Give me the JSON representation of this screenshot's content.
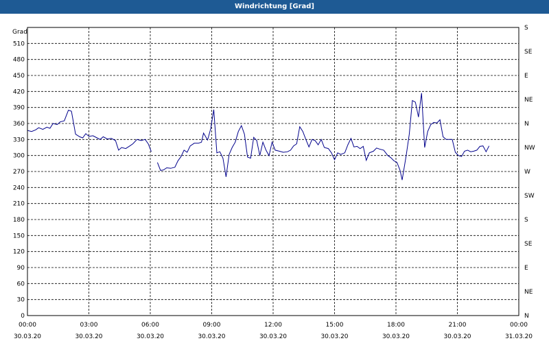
{
  "chart_data": {
    "type": "line",
    "title": "Windrichtung [Grad]",
    "ylabel": "Grad",
    "ylim": [
      0,
      540
    ],
    "yticks": [
      0,
      30,
      60,
      90,
      120,
      150,
      180,
      210,
      240,
      270,
      300,
      330,
      360,
      390,
      420,
      450,
      480,
      510
    ],
    "y2ticks": [
      {
        "value": 0,
        "label": "N"
      },
      {
        "value": 45,
        "label": "NE"
      },
      {
        "value": 90,
        "label": "E"
      },
      {
        "value": 135,
        "label": "SE"
      },
      {
        "value": 180,
        "label": "S"
      },
      {
        "value": 225,
        "label": "SW"
      },
      {
        "value": 270,
        "label": "W"
      },
      {
        "value": 315,
        "label": "NW"
      },
      {
        "value": 360,
        "label": "N"
      },
      {
        "value": 405,
        "label": "NE"
      },
      {
        "value": 450,
        "label": "E"
      },
      {
        "value": 495,
        "label": "SE"
      },
      {
        "value": 540,
        "label": "S"
      }
    ],
    "xlim": [
      0,
      24
    ],
    "xticks": [
      {
        "hour": 0,
        "time": "00:00",
        "date": "30.03.20"
      },
      {
        "hour": 3,
        "time": "03:00",
        "date": "30.03.20"
      },
      {
        "hour": 6,
        "time": "06:00",
        "date": "30.03.20"
      },
      {
        "hour": 9,
        "time": "09:00",
        "date": "30.03.20"
      },
      {
        "hour": 12,
        "time": "12:00",
        "date": "30.03.20"
      },
      {
        "hour": 15,
        "time": "15:00",
        "date": "30.03.20"
      },
      {
        "hour": 18,
        "time": "18:00",
        "date": "30.03.20"
      },
      {
        "hour": 21,
        "time": "21:00",
        "date": "30.03.20"
      },
      {
        "hour": 24,
        "time": "00:00",
        "date": "31.03.20"
      }
    ],
    "grid": true,
    "colors": {
      "line": "#00008b",
      "titlebar": "#1e5a94"
    },
    "series": [
      {
        "segments": [
          [
            [
              0.0,
              347
            ],
            [
              0.2,
              345
            ],
            [
              0.4,
              348
            ],
            [
              0.55,
              352
            ],
            [
              0.75,
              349
            ],
            [
              0.95,
              353
            ],
            [
              1.1,
              351
            ],
            [
              1.25,
              360
            ],
            [
              1.45,
              358
            ],
            [
              1.6,
              363
            ],
            [
              1.8,
              365
            ],
            [
              1.9,
              375
            ],
            [
              2.0,
              385
            ],
            [
              2.15,
              383
            ],
            [
              2.35,
              340
            ],
            [
              2.55,
              335
            ],
            [
              2.7,
              333
            ],
            [
              2.85,
              341
            ],
            [
              3.0,
              336
            ],
            [
              3.2,
              337
            ],
            [
              3.4,
              333
            ],
            [
              3.55,
              330
            ],
            [
              3.7,
              335
            ],
            [
              3.9,
              331
            ],
            [
              4.1,
              332
            ],
            [
              4.3,
              328
            ],
            [
              4.45,
              310
            ],
            [
              4.6,
              315
            ],
            [
              4.8,
              313
            ],
            [
              5.0,
              318
            ],
            [
              5.15,
              322
            ],
            [
              5.35,
              330
            ],
            [
              5.55,
              328
            ],
            [
              5.75,
              330
            ],
            [
              5.9,
              322
            ],
            [
              6.05,
              307
            ]
          ],
          [
            [
              6.35,
              287
            ],
            [
              6.5,
              272
            ],
            [
              6.65,
              273
            ],
            [
              6.8,
              277
            ],
            [
              7.0,
              276
            ],
            [
              7.2,
              278
            ],
            [
              7.35,
              290
            ],
            [
              7.5,
              298
            ],
            [
              7.65,
              310
            ],
            [
              7.8,
              306
            ],
            [
              7.95,
              318
            ],
            [
              8.15,
              323
            ],
            [
              8.35,
              323
            ],
            [
              8.5,
              325
            ],
            [
              8.6,
              342
            ],
            [
              8.8,
              329
            ],
            [
              8.95,
              350
            ],
            [
              9.1,
              386
            ],
            [
              9.25,
              305
            ],
            [
              9.4,
              307
            ],
            [
              9.55,
              295
            ],
            [
              9.7,
              260
            ],
            [
              9.85,
              302
            ],
            [
              10.0,
              315
            ],
            [
              10.15,
              325
            ],
            [
              10.3,
              345
            ],
            [
              10.45,
              356
            ],
            [
              10.6,
              340
            ],
            [
              10.75,
              297
            ],
            [
              10.9,
              295
            ],
            [
              11.05,
              334
            ],
            [
              11.2,
              328
            ],
            [
              11.35,
              300
            ],
            [
              11.5,
              325
            ],
            [
              11.65,
              310
            ],
            [
              11.8,
              300
            ],
            [
              11.95,
              325
            ],
            [
              12.1,
              310
            ],
            [
              12.3,
              308
            ],
            [
              12.5,
              306
            ],
            [
              12.7,
              307
            ],
            [
              12.85,
              310
            ],
            [
              13.0,
              318
            ],
            [
              13.15,
              322
            ],
            [
              13.3,
              354
            ],
            [
              13.45,
              345
            ],
            [
              13.6,
              330
            ],
            [
              13.75,
              316
            ],
            [
              13.9,
              330
            ],
            [
              14.05,
              328
            ],
            [
              14.2,
              320
            ],
            [
              14.35,
              330
            ],
            [
              14.5,
              315
            ],
            [
              14.7,
              313
            ],
            [
              14.85,
              305
            ],
            [
              15.0,
              292
            ],
            [
              15.15,
              305
            ],
            [
              15.3,
              302
            ],
            [
              15.5,
              305
            ],
            [
              15.65,
              320
            ],
            [
              15.8,
              332
            ],
            [
              15.95,
              316
            ],
            [
              16.1,
              317
            ],
            [
              16.25,
              313
            ],
            [
              16.4,
              317
            ],
            [
              16.55,
              291
            ],
            [
              16.7,
              305
            ],
            [
              16.9,
              308
            ],
            [
              17.05,
              314
            ],
            [
              17.2,
              312
            ],
            [
              17.4,
              310
            ],
            [
              17.6,
              300
            ],
            [
              17.75,
              296
            ],
            [
              17.9,
              290
            ],
            [
              18.05,
              287
            ],
            [
              18.2,
              272
            ],
            [
              18.3,
              254
            ],
            [
              18.5,
              300
            ],
            [
              18.65,
              340
            ],
            [
              18.8,
              403
            ],
            [
              18.95,
              400
            ],
            [
              19.1,
              372
            ],
            [
              19.25,
              417
            ],
            [
              19.4,
              315
            ],
            [
              19.55,
              345
            ],
            [
              19.7,
              358
            ],
            [
              19.85,
              362
            ],
            [
              20.0,
              361
            ],
            [
              20.15,
              367
            ],
            [
              20.3,
              335
            ],
            [
              20.45,
              330
            ],
            [
              20.6,
              330
            ],
            [
              20.75,
              330
            ],
            [
              20.9,
              306
            ],
            [
              21.05,
              300
            ],
            [
              21.2,
              298
            ],
            [
              21.35,
              308
            ],
            [
              21.5,
              310
            ],
            [
              21.65,
              307
            ],
            [
              21.8,
              308
            ],
            [
              21.95,
              310
            ],
            [
              22.1,
              317
            ],
            [
              22.25,
              318
            ],
            [
              22.4,
              307
            ],
            [
              22.55,
              318
            ]
          ]
        ]
      }
    ]
  }
}
